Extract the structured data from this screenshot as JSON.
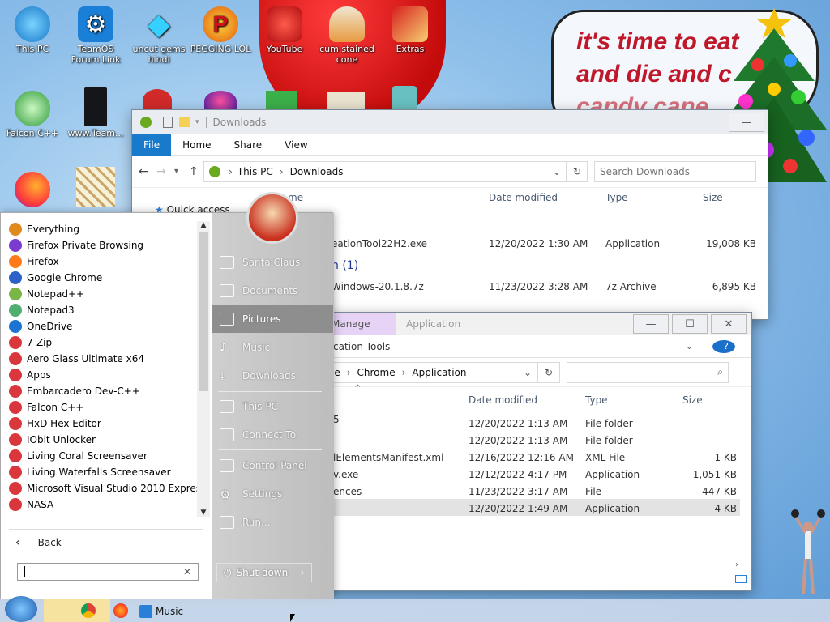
{
  "desktop": {
    "icons": [
      {
        "label": "This PC"
      },
      {
        "label": "TeamOS Forum Link"
      },
      {
        "label": "uncut gems hindi"
      },
      {
        "label": "PEGGING LOL"
      },
      {
        "label": "YouTube"
      },
      {
        "label": "cum stained cone"
      },
      {
        "label": "Extras"
      },
      {
        "label": "Falcon C++"
      },
      {
        "label": "www.Team..."
      }
    ],
    "bubble_lines": [
      "it's time to eat",
      "and die and c",
      "candy cane"
    ]
  },
  "explorer_downloads": {
    "title": "Downloads",
    "ribbon": [
      "File",
      "Home",
      "Share",
      "View"
    ],
    "breadcrumb": [
      "This PC",
      "Downloads"
    ],
    "search_placeholder": "Search Downloads",
    "columns": [
      "me",
      "Date modified",
      "Type",
      "Size"
    ],
    "quick_access": "Quick access",
    "group_label": "h (1)",
    "rows": [
      {
        "name": "eationTool22H2.exe",
        "date": "12/20/2022 1:30 AM",
        "type": "Application",
        "size": "19,008 KB"
      },
      {
        "name": "Windows-20.1.8.7z",
        "date": "11/23/2022 3:28 AM",
        "type": "7z Archive",
        "size": "6,895 KB"
      }
    ]
  },
  "explorer_chrome": {
    "tabs": [
      "Manage",
      "Application"
    ],
    "subtab": "cation Tools",
    "breadcrumb": [
      "le",
      "Chrome",
      "Application"
    ],
    "columns": [
      "Date modified",
      "Type",
      "Size"
    ],
    "rows": [
      {
        "name": "5",
        "date": "12/20/2022 1:13 AM",
        "type": "File folder",
        "size": ""
      },
      {
        "name": "",
        "date": "12/20/2022 1:13 AM",
        "type": "File folder",
        "size": ""
      },
      {
        "name": "lElementsManifest.xml",
        "date": "12/16/2022 12:16 AM",
        "type": "XML File",
        "size": "1 KB"
      },
      {
        "name": "v.exe",
        "date": "12/12/2022 4:17 PM",
        "type": "Application",
        "size": "1,051 KB"
      },
      {
        "name": "ences",
        "date": "11/23/2022 3:17 AM",
        "type": "File",
        "size": "447 KB"
      },
      {
        "name": "",
        "date": "12/20/2022 1:49 AM",
        "type": "Application",
        "size": "4 KB"
      }
    ]
  },
  "start_menu": {
    "programs": [
      {
        "label": "Everything",
        "color": "#e08a1e"
      },
      {
        "label": "Firefox Private Browsing",
        "color": "#7a3bd1"
      },
      {
        "label": "Firefox",
        "color": "#ff7a1a"
      },
      {
        "label": "Google Chrome",
        "color": "#2b62c9"
      },
      {
        "label": "Notepad++",
        "color": "#7ab648"
      },
      {
        "label": "Notepad3",
        "color": "#4fae72"
      },
      {
        "label": "OneDrive",
        "color": "#1b73d2"
      },
      {
        "label": "7-Zip",
        "color": "#d9363e"
      },
      {
        "label": "Aero Glass Ultimate x64",
        "color": "#d9363e"
      },
      {
        "label": "Apps",
        "color": "#d9363e"
      },
      {
        "label": "Embarcadero Dev-C++",
        "color": "#d9363e"
      },
      {
        "label": "Falcon C++",
        "color": "#d9363e"
      },
      {
        "label": "HxD Hex Editor",
        "color": "#d9363e"
      },
      {
        "label": "IObit Unlocker",
        "color": "#d9363e"
      },
      {
        "label": "Living Coral Screensaver",
        "color": "#d9363e"
      },
      {
        "label": "Living Waterfalls Screensaver",
        "color": "#d9363e"
      },
      {
        "label": "Microsoft Visual Studio 2010 Express",
        "color": "#d9363e"
      },
      {
        "label": "NASA",
        "color": "#d9363e"
      }
    ],
    "back_label": "Back",
    "right_items": [
      "Santa Claus",
      "Documents",
      "Pictures",
      "Music",
      "Downloads",
      "This PC",
      "Connect To",
      "Control Panel",
      "Settings",
      "Run..."
    ],
    "shutdown_label": "Shut down"
  },
  "taskbar": {
    "items": [
      "Music"
    ]
  }
}
